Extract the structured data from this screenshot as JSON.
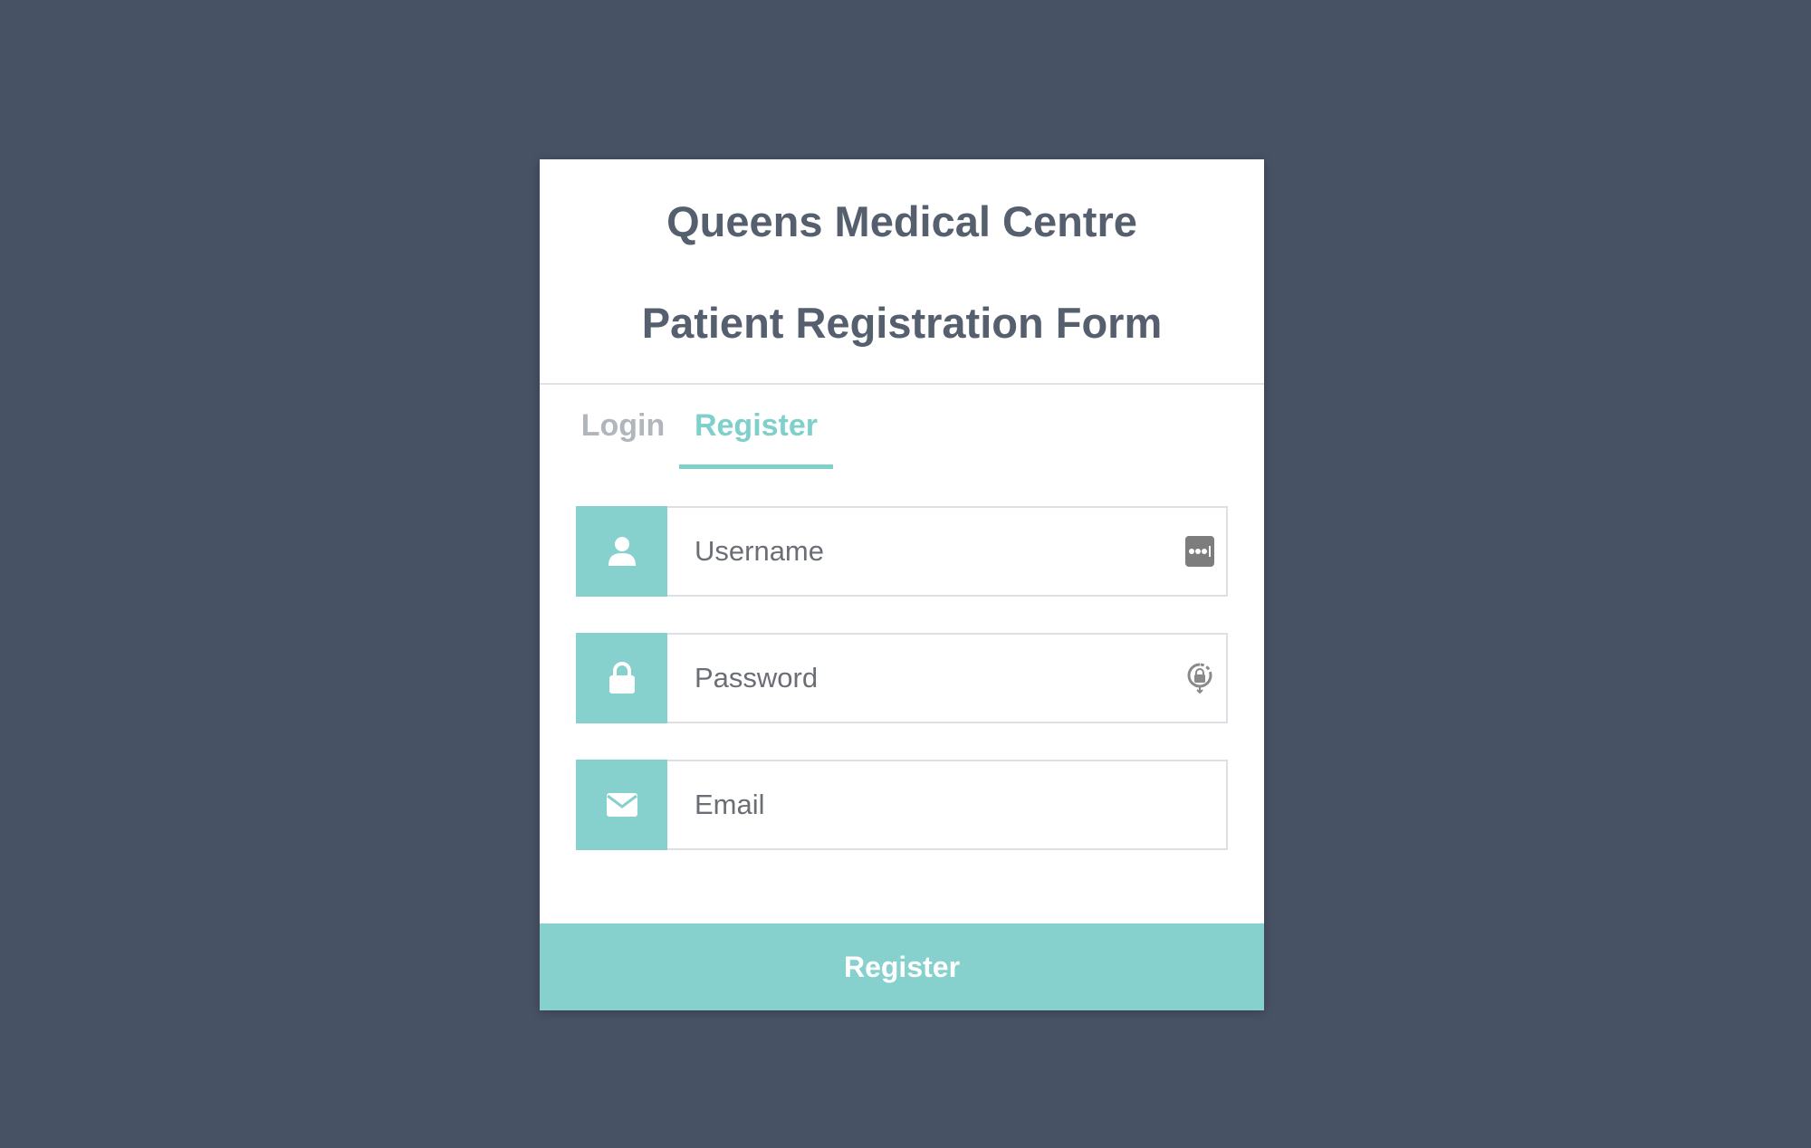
{
  "header": {
    "title_line1": "Queens Medical Centre",
    "title_line2": "Patient Registration Form"
  },
  "tabs": [
    {
      "label": "Login",
      "active": false
    },
    {
      "label": "Register",
      "active": true
    }
  ],
  "form": {
    "username": {
      "placeholder": "Username",
      "value": "",
      "icon": "user-icon",
      "trailing_icon": "password-manager-icon"
    },
    "password": {
      "placeholder": "Password",
      "value": "",
      "icon": "lock-icon",
      "trailing_icon": "password-autofill-key-icon"
    },
    "email": {
      "placeholder": "Email",
      "value": "",
      "icon": "envelope-icon"
    }
  },
  "submit_label": "Register",
  "colors": {
    "background": "#475264",
    "accent": "#86d1ce",
    "title_text": "#555f6e",
    "inactive_tab": "#b1b6bd"
  }
}
